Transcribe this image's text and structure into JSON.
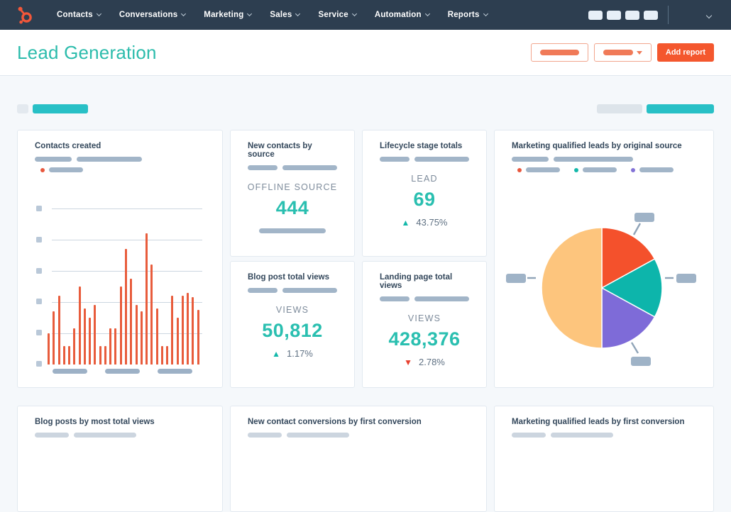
{
  "nav": {
    "items": [
      {
        "label": "Contacts"
      },
      {
        "label": "Conversations"
      },
      {
        "label": "Marketing"
      },
      {
        "label": "Sales"
      },
      {
        "label": "Service"
      },
      {
        "label": "Automation"
      },
      {
        "label": "Reports"
      }
    ]
  },
  "header": {
    "title": "Lead Generation",
    "add_report_label": "Add report"
  },
  "cards": {
    "contacts_created": {
      "title": "Contacts created"
    },
    "new_contacts_by_source": {
      "title": "New contacts by source",
      "label": "OFFLINE SOURCE",
      "value": "444"
    },
    "lifecycle_stage_totals": {
      "title": "Lifecycle stage totals",
      "label": "LEAD",
      "value": "69",
      "delta": "43.75%",
      "delta_direction": "up"
    },
    "mql_by_original_source": {
      "title": "Marketing qualified leads by original source"
    },
    "blog_post_total_views": {
      "title": "Blog post total views",
      "label": "VIEWS",
      "value": "50,812",
      "delta": "1.17%",
      "delta_direction": "up"
    },
    "landing_page_total_views": {
      "title": "Landing page total views",
      "label": "VIEWS",
      "value": "428,376",
      "delta": "2.78%",
      "delta_direction": "down"
    },
    "blog_posts_by_most_total_views": {
      "title": "Blog posts by most total views"
    },
    "new_contact_conversions_by_first_conversion": {
      "title": "New contact conversions by first conversion"
    },
    "mql_by_first_conversion": {
      "title": "Marketing qualified leads by first conversion"
    }
  },
  "chart_data": [
    {
      "type": "bar",
      "title": "Contacts created",
      "values": [
        20,
        34,
        44,
        12,
        12,
        23,
        50,
        36,
        30,
        38,
        12,
        12,
        23,
        23,
        50,
        74,
        55,
        38,
        34,
        84,
        64,
        36,
        12,
        12,
        44,
        30,
        44,
        46,
        43,
        35
      ],
      "ylim": [
        0,
        100
      ],
      "bar_color": "#e85c3c",
      "grid": true,
      "gridline_count": 5
    },
    {
      "type": "pie",
      "title": "Marketing qualified leads by original source",
      "slices": [
        {
          "name": "slice-1",
          "value": 17,
          "color": "#f4512c"
        },
        {
          "name": "slice-2",
          "value": 16,
          "color": "#0db5ab"
        },
        {
          "name": "slice-3",
          "value": 17,
          "color": "#7e6bd8"
        },
        {
          "name": "slice-4",
          "value": 50,
          "color": "#fdc57d"
        }
      ],
      "legend_dot_colors": [
        "#e8573d",
        "#14b8aa",
        "#8372d6"
      ],
      "legend_position": "top"
    }
  ],
  "colors": {
    "nav_bg": "#2d3e50",
    "accent_teal": "#2cbcac",
    "brand_orange": "#f4572e",
    "delta_up": "#14b8aa",
    "delta_down": "#e8402f",
    "placeholder_gray_blue": "#a2b5c8"
  }
}
